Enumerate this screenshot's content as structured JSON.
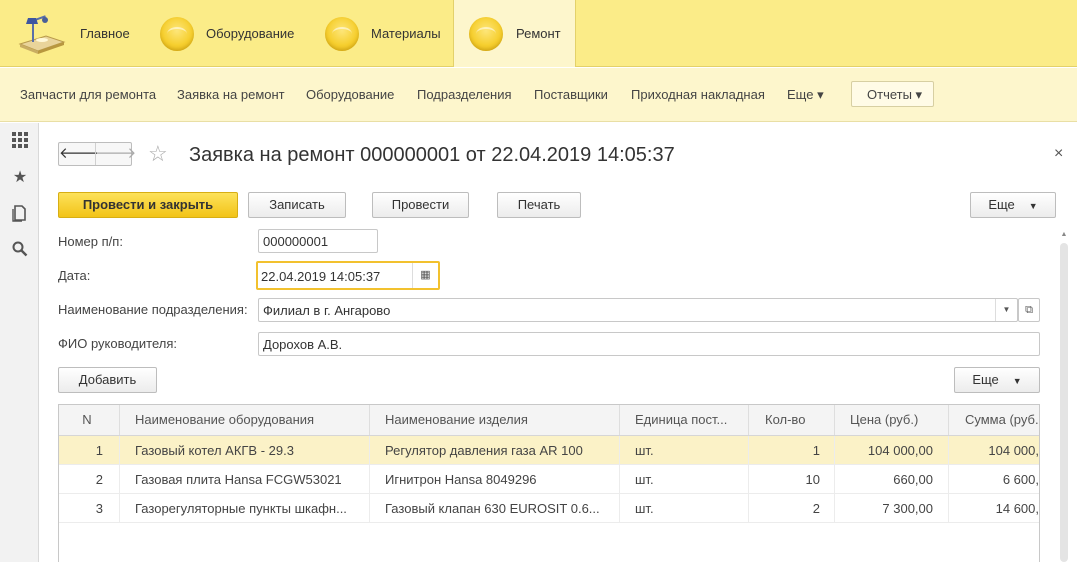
{
  "sections": [
    {
      "label": "Главное",
      "icon": "desk-lamp-icon"
    },
    {
      "label": "Оборудование",
      "icon": "coin-icon"
    },
    {
      "label": "Материалы",
      "icon": "coin-icon"
    },
    {
      "label": "Ремонт",
      "icon": "coin-icon",
      "active": true
    }
  ],
  "subnav": {
    "items": [
      "Запчасти для ремонта",
      "Заявка на ремонт",
      "Оборудование",
      "Подразделения",
      "Поставщики",
      "Приходная накладная",
      "Еще ▾"
    ],
    "reports": "Отчеты ▾"
  },
  "form": {
    "nav_back": "🡐",
    "nav_forward": "🡒",
    "title": "Заявка на ремонт 000000001 от 22.04.2019 14:05:37",
    "close": "×",
    "buttons": {
      "post_close": "Провести и закрыть",
      "save": "Записать",
      "post": "Провести",
      "print": "Печать",
      "more": "Еще"
    },
    "fields": {
      "number_label": "Номер п/п:",
      "number_value": "000000001",
      "date_label": "Дата:",
      "date_value": "22.04.2019 14:05:37",
      "division_label": "Наименование подразделения:",
      "division_value": "Филиал в г. Ангарово",
      "manager_label": "ФИО руководителя:",
      "manager_value": "Дорохов А.В."
    },
    "table_buttons": {
      "add": "Добавить",
      "more": "Еще"
    }
  },
  "table": {
    "headers": [
      "N",
      "Наименование оборудования",
      "Наименование изделия",
      "Единица пост...",
      "Кол-во",
      "Цена (руб.)",
      "Сумма (руб."
    ],
    "rows": [
      [
        "1",
        "Газовый котел АКГВ - 29.3",
        "Регулятор давления газа AR 100",
        "шт.",
        "1",
        "104 000,00",
        "104 000,"
      ],
      [
        "2",
        "Газовая плита Hansa FCGW53021",
        "Игнитрон Hansa 8049296",
        "шт.",
        "10",
        "660,00",
        "6 600,"
      ],
      [
        "3",
        "Газорегуляторные пункты шкафн...",
        "Газовый клапан 630 EUROSIT 0.6...",
        "шт.",
        "2",
        "7 300,00",
        "14 600,"
      ]
    ]
  },
  "colors": {
    "topbar": "#fbec88",
    "subnav": "#fdf6cc",
    "primary_button": "#f2c318",
    "selected_row": "#fbf2c7",
    "focus_border": "#f2c12e"
  }
}
